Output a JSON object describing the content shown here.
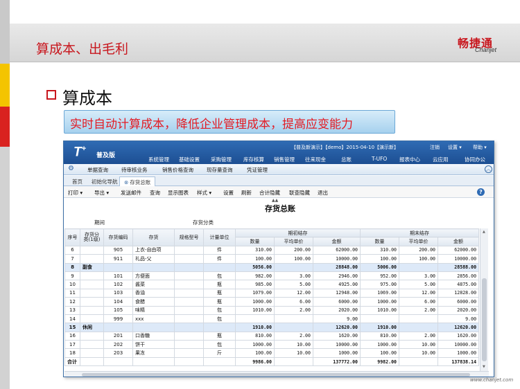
{
  "slide": {
    "title": "算成本、出毛利",
    "logo_cn": "畅捷通",
    "logo_en": "Chanjet",
    "bullet": "算成本",
    "highlight": "实时自动计算成本，降低企业管理成本，提高应变能力",
    "watermark": "www.chanjet.com"
  },
  "colors": {
    "brand_red": "#c8161d",
    "header_blue": "#2f6bb4",
    "subtotal_row": "#dde9f8"
  },
  "app": {
    "brand": "T",
    "brand_sup": "+",
    "brand_sub": "普及版",
    "status": "【普及新演示】【demo】2015-04-10【演示新】",
    "user_menu": [
      "注销",
      "设置 ▾",
      "帮助 ▾"
    ],
    "main_nav": [
      "系统管理",
      "基础设置",
      "采购管理",
      "库存核算",
      "销售管理",
      "往来现金",
      "总账",
      "T-UFO",
      "报表中心",
      "云应用",
      "协同办公"
    ],
    "sub_nav": [
      "单据查询",
      "待审核业务",
      "销售价格查询",
      "现存量查询",
      "凭证管理"
    ],
    "sub_nav_icon": "gear-icon",
    "tabs": [
      {
        "label": "首页",
        "active": false
      },
      {
        "label": "初始化导航",
        "active": false
      },
      {
        "label": "存货总账",
        "active": true
      }
    ],
    "toolbar": [
      "打印 ▾",
      "导出 ▾",
      "发送邮件",
      "查询",
      "显示图表",
      "样式 ▾",
      "设置",
      "刷新",
      "合计隐藏",
      "联查隐藏",
      "退出"
    ],
    "help_label": "?"
  },
  "report": {
    "title": "存货总账",
    "filter_labels": [
      "期间",
      "存货分类"
    ],
    "headers": {
      "seq": "序号",
      "category": "存货分类(1级)",
      "code": "存货编码",
      "item": "存货",
      "spec": "规格型号",
      "unit": "计量单位",
      "opening": "期初结存",
      "closing": "期末结存",
      "qty": "数量",
      "avg": "平均单价",
      "amount": "金额"
    },
    "rows": [
      {
        "seq": "6",
        "cat": "",
        "code": "905",
        "item": "上衣-自由项",
        "spec": "",
        "unit": "件",
        "oq": "310.00",
        "op": "200.00",
        "oa": "62000.00",
        "cq": "310.00",
        "cp": "200.00",
        "ca": "62000.00",
        "sub": false
      },
      {
        "seq": "7",
        "cat": "",
        "code": "911",
        "item": "礼品-父",
        "spec": "",
        "unit": "件",
        "oq": "100.00",
        "op": "100.00",
        "oa": "10000.00",
        "cq": "100.00",
        "cp": "100.00",
        "ca": "10000.00",
        "sub": false
      },
      {
        "seq": "8",
        "cat": "副食",
        "code": "",
        "item": "",
        "spec": "",
        "unit": "",
        "oq": "5056.00",
        "op": "",
        "oa": "28848.00",
        "cq": "5006.00",
        "cp": "",
        "ca": "28588.00",
        "sub": true
      },
      {
        "seq": "9",
        "cat": "",
        "code": "101",
        "item": "方便面",
        "spec": "",
        "unit": "包",
        "oq": "982.00",
        "op": "3.00",
        "oa": "2946.00",
        "cq": "952.00",
        "cp": "3.00",
        "ca": "2856.00",
        "sub": false
      },
      {
        "seq": "10",
        "cat": "",
        "code": "102",
        "item": "酱菜",
        "spec": "",
        "unit": "瓶",
        "oq": "985.00",
        "op": "5.00",
        "oa": "4925.00",
        "cq": "975.00",
        "cp": "5.00",
        "ca": "4875.00",
        "sub": false
      },
      {
        "seq": "11",
        "cat": "",
        "code": "103",
        "item": "香油",
        "spec": "",
        "unit": "瓶",
        "oq": "1079.00",
        "op": "12.00",
        "oa": "12948.00",
        "cq": "1069.00",
        "cp": "12.00",
        "ca": "12828.00",
        "sub": false
      },
      {
        "seq": "12",
        "cat": "",
        "code": "104",
        "item": "食醋",
        "spec": "",
        "unit": "瓶",
        "oq": "1000.00",
        "op": "6.00",
        "oa": "6000.00",
        "cq": "1000.00",
        "cp": "6.00",
        "ca": "6000.00",
        "sub": false
      },
      {
        "seq": "13",
        "cat": "",
        "code": "105",
        "item": "味精",
        "spec": "",
        "unit": "包",
        "oq": "1010.00",
        "op": "2.00",
        "oa": "2020.00",
        "cq": "1010.00",
        "cp": "2.00",
        "ca": "2020.00",
        "sub": false
      },
      {
        "seq": "14",
        "cat": "",
        "code": "999",
        "item": "xxx",
        "spec": "",
        "unit": "包",
        "oq": "",
        "op": "",
        "oa": "9.00",
        "cq": "",
        "cp": "",
        "ca": "9.00",
        "sub": false
      },
      {
        "seq": "15",
        "cat": "休闲",
        "code": "",
        "item": "",
        "spec": "",
        "unit": "",
        "oq": "1910.00",
        "op": "",
        "oa": "12620.00",
        "cq": "1910.00",
        "cp": "",
        "ca": "12620.00",
        "sub": true
      },
      {
        "seq": "16",
        "cat": "",
        "code": "201",
        "item": "口香糖",
        "spec": "",
        "unit": "瓶",
        "oq": "810.00",
        "op": "2.00",
        "oa": "1620.00",
        "cq": "810.00",
        "cp": "2.00",
        "ca": "1620.00",
        "sub": false
      },
      {
        "seq": "17",
        "cat": "",
        "code": "202",
        "item": "饼干",
        "spec": "",
        "unit": "包",
        "oq": "1000.00",
        "op": "10.00",
        "oa": "10000.00",
        "cq": "1000.00",
        "cp": "10.00",
        "ca": "10000.00",
        "sub": false
      },
      {
        "seq": "18",
        "cat": "",
        "code": "203",
        "item": "果冻",
        "spec": "",
        "unit": "斤",
        "oq": "100.00",
        "op": "10.00",
        "oa": "1000.00",
        "cq": "100.00",
        "cp": "10.00",
        "ca": "1000.00",
        "sub": false
      }
    ],
    "total": {
      "label": "合计",
      "oq": "9986.00",
      "oa": "137772.00",
      "cq": "9982.00",
      "ca": "137838.14"
    }
  }
}
